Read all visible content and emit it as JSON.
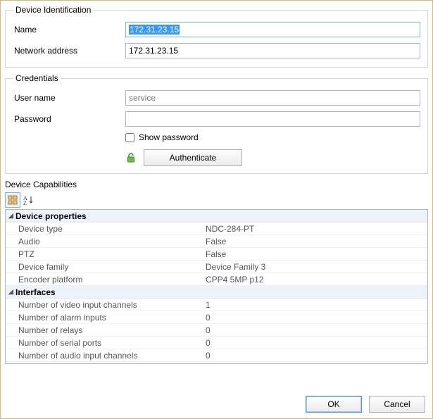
{
  "identification": {
    "legend": "Device Identification",
    "name_label": "Name",
    "name_value": "172.31.23.15",
    "address_label": "Network address",
    "address_value": "172.31.23.15"
  },
  "credentials": {
    "legend": "Credentials",
    "user_label": "User name",
    "user_value": "service",
    "password_label": "Password",
    "password_value": "",
    "show_password_label": "Show password",
    "authenticate_label": "Authenticate"
  },
  "capabilities": {
    "label": "Device Capabilities",
    "categories": [
      {
        "name": "Device properties",
        "rows": [
          {
            "k": "Device type",
            "v": "NDC-284-PT"
          },
          {
            "k": "Audio",
            "v": "False"
          },
          {
            "k": "PTZ",
            "v": "False"
          },
          {
            "k": "Device family",
            "v": "Device Family 3"
          },
          {
            "k": "Encoder platform",
            "v": "CPP4 5MP p12"
          }
        ]
      },
      {
        "name": "Interfaces",
        "rows": [
          {
            "k": "Number of video input channels",
            "v": "1"
          },
          {
            "k": "Number of alarm inputs",
            "v": "0"
          },
          {
            "k": "Number of relays",
            "v": "0"
          },
          {
            "k": "Number of serial ports",
            "v": "0"
          },
          {
            "k": "Number of audio input channels",
            "v": "0"
          }
        ]
      }
    ]
  },
  "buttons": {
    "ok": "OK",
    "cancel": "Cancel"
  },
  "icons": {
    "categorized": "categorized-icon",
    "alphabetical": "alphabetical-icon",
    "unlock": "unlock-icon"
  }
}
